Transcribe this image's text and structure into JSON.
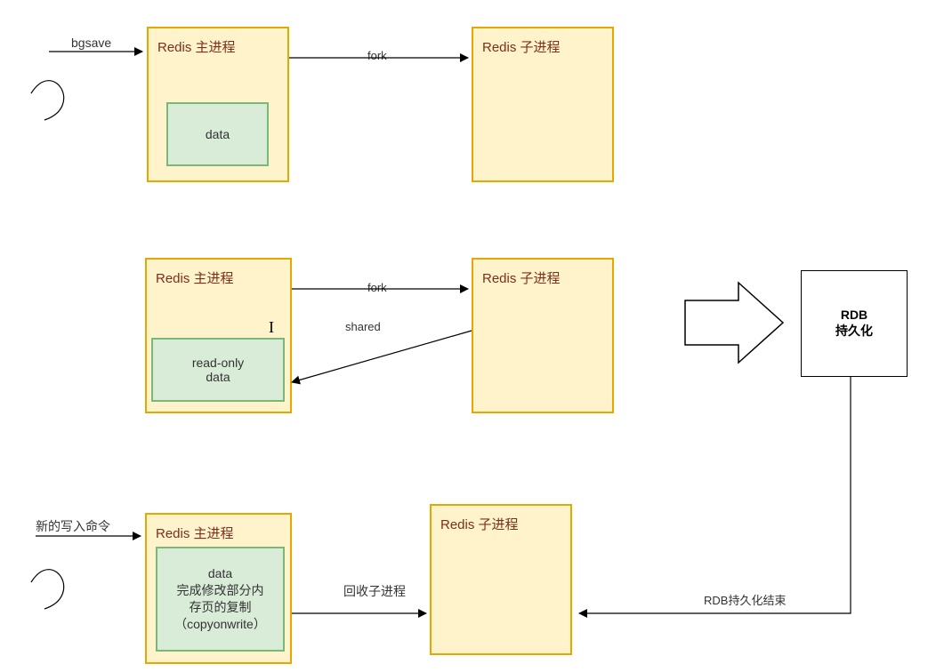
{
  "stage1": {
    "incoming_label": "bgsave",
    "main_title": "Redis 主进程",
    "data_label": "data",
    "fork_label": "fork",
    "child_title": "Redis 子进程"
  },
  "stage2": {
    "main_title": "Redis 主进程",
    "data_line1": "read-only",
    "data_line2": "data",
    "fork_label": "fork",
    "shared_label": "shared",
    "child_title": "Redis 子进程"
  },
  "stage3": {
    "incoming_label": "新的写入命令",
    "main_title": "Redis 主进程",
    "data_line1": "data",
    "data_line2": "完成修改部分内",
    "data_line3": "存页的复制",
    "data_line4": "（copyonwrite）",
    "reap_label": "回收子进程",
    "child_title": "Redis 子进程"
  },
  "rdb": {
    "box_line1": "RDB",
    "box_line2": "持久化",
    "end_label": "RDB持久化结束"
  }
}
